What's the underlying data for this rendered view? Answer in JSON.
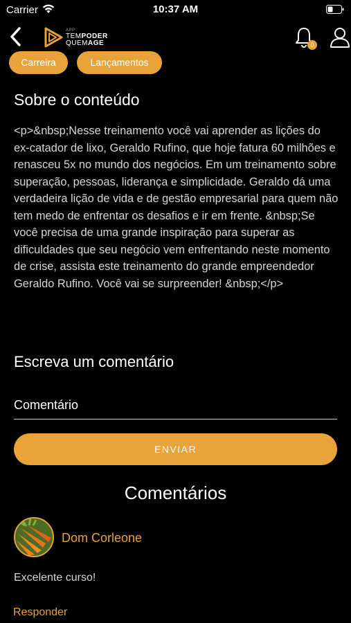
{
  "status_bar": {
    "carrier": "Carrier",
    "time": "10:37 AM"
  },
  "nav": {
    "brand_small": "APP",
    "brand_line1_a": "TEM",
    "brand_line1_b": "PODER",
    "brand_line2_a": "QUEM",
    "brand_line2_b": "AGE",
    "notification_count": "0",
    "icons": [
      "back-chevron-icon",
      "play-logo-icon",
      "bell-icon",
      "user-icon"
    ]
  },
  "chips": [
    "Carreira",
    "Lançamentos"
  ],
  "about": {
    "title": "Sobre o conteúdo",
    "text": "<p>&nbsp;Nesse treinamento você vai aprender as lições do ex-catador de lixo, Geraldo Rufino, que hoje fatura 60 milhões e renasceu 5x no mundo dos negócios. Em um treinamento sobre superação, pessoas, liderança e simplicidade. Geraldo dá uma verdadeira lição de vida e de gestão empresarial para quem não tem medo de enfrentar os desafios e ir em frente. &nbsp;Se você precisa de uma grande inspiração para superar as dificuldades que seu negócio vem enfrentando neste momento de crise, assista este treinamento do grande empreendedor Geraldo Rufino. Você vai se surpreender! &nbsp;</p>"
  },
  "comment_form": {
    "heading": "Escreva um comentário",
    "placeholder": "Comentário",
    "value": "",
    "submit_label": "ENVIAR"
  },
  "comments": {
    "heading": "Comentários",
    "items": [
      {
        "author": "Dom Corleone",
        "text": "Excelente curso!",
        "reply_label": "Responder"
      }
    ]
  },
  "colors": {
    "accent": "#E8A33A",
    "background": "#000000",
    "body_text": "#D6D6D6"
  }
}
